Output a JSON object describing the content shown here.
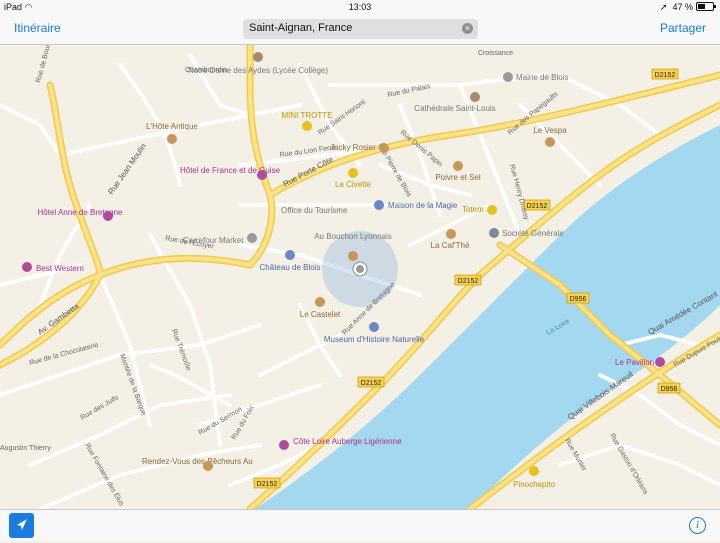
{
  "status": {
    "device": "iPad",
    "time": "13:03",
    "battery": "47 %",
    "battery_level": 0.47
  },
  "nav": {
    "left": "Itinéraire",
    "search_value": "Saint-Aignan, France",
    "right": "Partager"
  },
  "colors": {
    "accent": "#1a7ce0",
    "water": "#a4d8f0",
    "land": "#f4f0e6",
    "major_road": "#f8dc60"
  },
  "road_labels": [
    "D2152",
    "D2152",
    "D2152",
    "D2152",
    "D2152",
    "D956",
    "D956"
  ],
  "streets": [
    "Rue de Bourgogne",
    "Chambourdin",
    "Rue du Palais",
    "Rue Saint-Honoré",
    "Rue du Lion Ferré",
    "Rue Porte Côte",
    "Rue Denis Papin",
    "Rue des Papegaults",
    "Rue Pierre de Blois",
    "Rue Jean Moulin",
    "Rue Henry Drussy",
    "Rue Anne de Bretagne",
    "Rue de l'Écuyer",
    "Av. Gambetta",
    "Rue de la Chocolaterie",
    "Rue Trémoïlle",
    "Rue du Sermon",
    "Rue du Foix",
    "Montée de la Barque",
    "Quai Amédée Contant",
    "Quai Villebois-Mareuil",
    "La Loire",
    "Rue Dupuis Poulet",
    "Rue Gaston d'Orléans",
    "Rue Munier",
    "Augustin Thierry",
    "Rue des Juifs",
    "Rue Fontaine des Élus",
    "Croissance"
  ],
  "pois": {
    "notre_dame": "Notre Dame des Aydes (Lycée Collège)",
    "mini_trotte": "MINI TROTTE",
    "hotantique": "L'Hôte Antique",
    "mairie": "Mairie de Blois",
    "cathedrale": "Cathédrale Saint-Louis",
    "vespa": "Le Vespa",
    "jacky": "Jacky Rosier",
    "hotel_france": "Hôtel de France et de Guise",
    "civette": "La Civette",
    "poivre": "Poivre et Sel",
    "totem": "Totem",
    "hotel_anne": "Hôtel Anne de Bretagne",
    "office": "Office du Tourisme",
    "magie": "Maison de la Magie",
    "societe": "Société Générale",
    "cafthe": "La Caf'Thé",
    "carrefour": "Carrefour Market",
    "bouchon": "Au Bouchon Lyonnais",
    "best_western": "Best Western",
    "chateau": "Château de Blois",
    "castelet": "Le Castelet",
    "museum": "Museum d'Histoire Naturelle",
    "pavillon": "Le Pavillon",
    "cote_loire": "Côte Loire Auberge Ligérienne",
    "rendez_vous": "Rendez-Vous des Pêcheurs Au",
    "pinochapito": "Pinochapito"
  },
  "bottom": {
    "info": "i"
  }
}
